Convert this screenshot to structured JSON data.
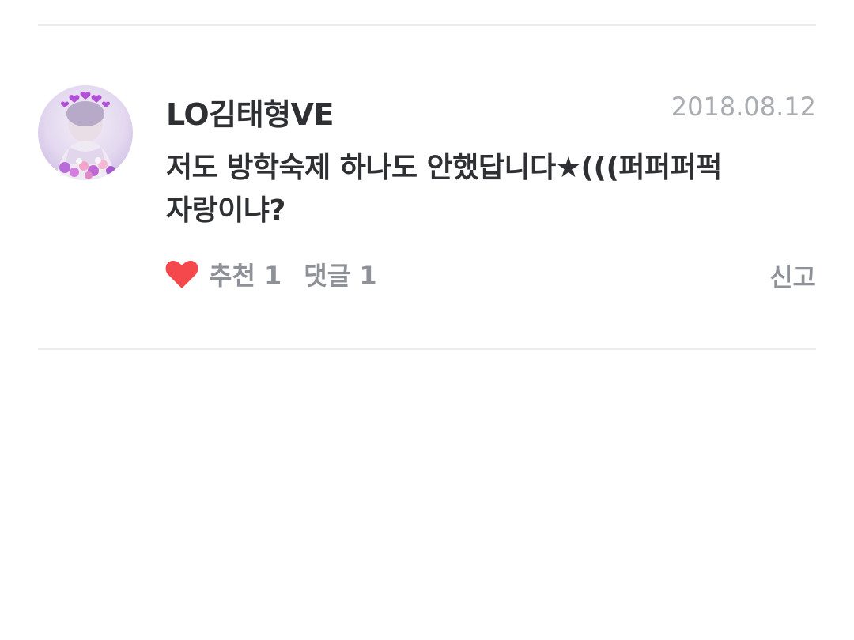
{
  "comment": {
    "author": "LO김태형VE",
    "date": "2018.08.12",
    "body_line1": "저도 방학숙제 하나도 안했답니다★(((퍼퍼퍼퍽",
    "body_line2": "자랑이냐?",
    "avatar_icon": "user-avatar-photo",
    "like_icon": "heart-icon",
    "like_color": "#f4484d",
    "recommend_label": "추천 1",
    "reply_label": "댓글 1",
    "report_label": "신고"
  },
  "colors": {
    "text_primary": "#2f3033",
    "text_secondary": "#8e9197",
    "text_date": "#a9acb1",
    "divider": "#ececec"
  }
}
